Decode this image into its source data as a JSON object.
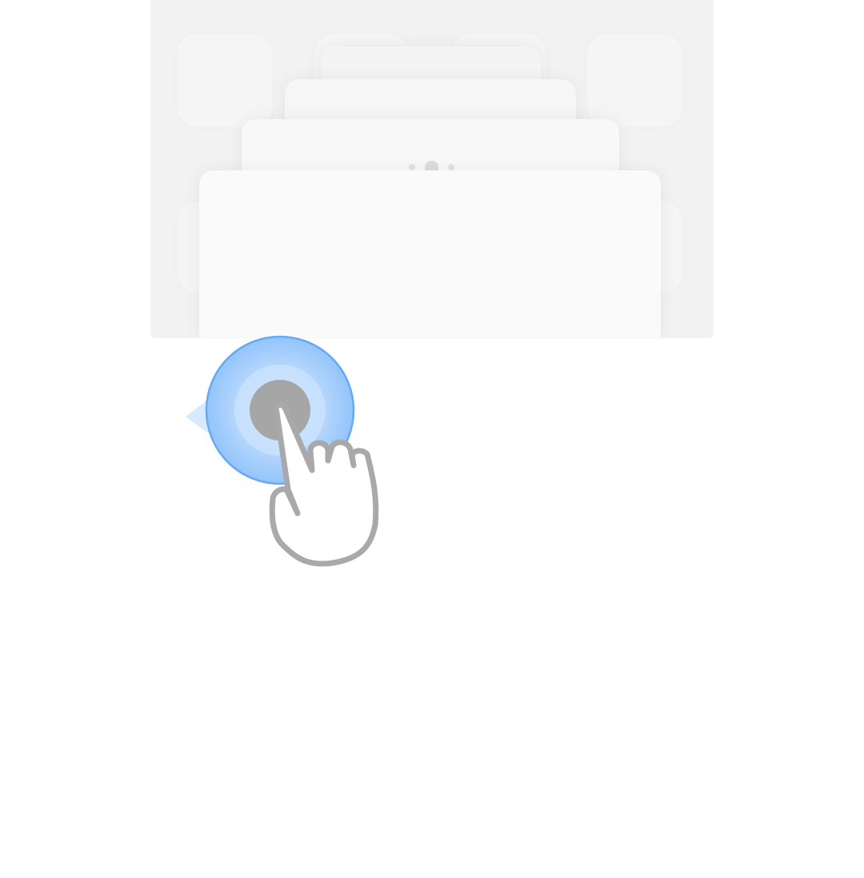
{
  "screen": {
    "background": "#ffffff",
    "panel_color": "#f2f2f2",
    "card_colors": [
      "#f4f4f4",
      "#f6f6f6",
      "#f8f8f8",
      "#fafafa"
    ],
    "page_indicator": {
      "count": 3,
      "active_index": 1
    }
  },
  "gesture_hint": {
    "type": "swipe-left",
    "icon": "tap-hand-icon",
    "ring_color": "#64aaf4",
    "arrow_color": "#cfe6fd",
    "hand_outline_color": "#a9a9a9"
  }
}
